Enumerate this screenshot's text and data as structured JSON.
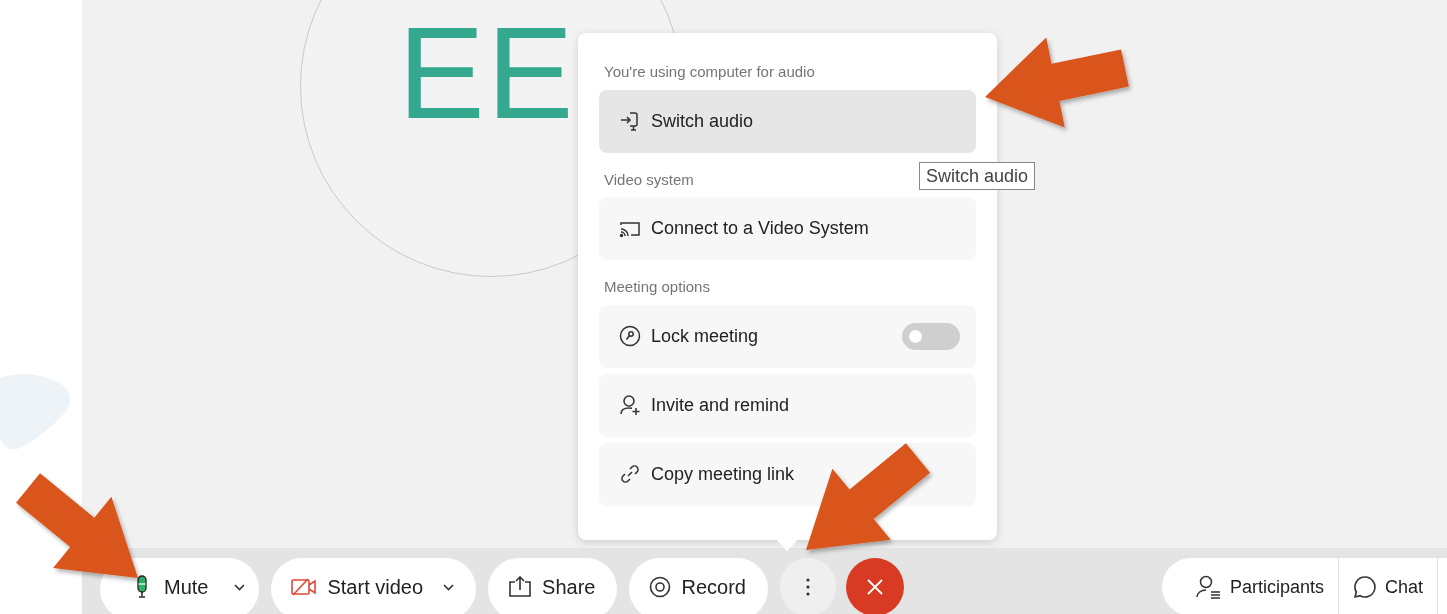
{
  "avatar": {
    "initials": "EE"
  },
  "menu": {
    "sections": [
      {
        "heading": "You're using computer for audio",
        "items": [
          {
            "kind": "action",
            "label": "Switch audio",
            "highlighted": true
          }
        ]
      },
      {
        "heading": "Video system",
        "items": [
          {
            "kind": "action",
            "label": "Connect to a Video System",
            "highlighted": false
          }
        ]
      },
      {
        "heading": "Meeting options",
        "items": [
          {
            "kind": "toggle",
            "label": "Lock meeting",
            "highlighted": false,
            "on": false
          },
          {
            "kind": "action",
            "label": "Invite and remind",
            "highlighted": false
          },
          {
            "kind": "action",
            "label": "Copy meeting link",
            "highlighted": false
          }
        ]
      }
    ]
  },
  "tooltip": {
    "text": "Switch audio"
  },
  "toolbar": {
    "buttons": [
      {
        "kind": "mute",
        "label": "Mute",
        "dropdown": true
      },
      {
        "kind": "video",
        "label": "Start video",
        "dropdown": true
      },
      {
        "kind": "share",
        "label": "Share",
        "dropdown": false
      },
      {
        "kind": "record",
        "label": "Record",
        "dropdown": false
      },
      {
        "kind": "more",
        "dropdown": false
      },
      {
        "kind": "end",
        "dropdown": false
      }
    ],
    "right": [
      {
        "kind": "participants",
        "label": "Participants"
      },
      {
        "kind": "chat",
        "label": "Chat"
      }
    ]
  }
}
